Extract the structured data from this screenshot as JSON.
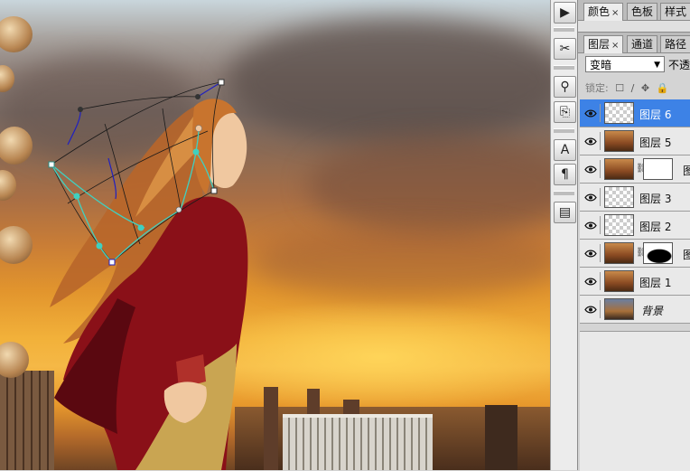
{
  "toolstrip": {
    "icons": [
      "play-icon",
      "brush-tools-icon",
      "clone-stamp-icon",
      "history-brush-icon",
      "character-icon",
      "paragraph-icon",
      "layer-comps-icon"
    ],
    "glyphs": [
      "▶",
      "✂",
      "⚲",
      "⎘",
      "A",
      "¶",
      "▤"
    ]
  },
  "panel_top": {
    "tabs": [
      {
        "label": "颜色",
        "close": "×"
      },
      {
        "label": "色板"
      },
      {
        "label": "样式"
      }
    ]
  },
  "layers_panel": {
    "tabs": [
      {
        "label": "图层",
        "close": "×"
      },
      {
        "label": "通道"
      },
      {
        "label": "路径"
      }
    ],
    "blend_mode": "变暗",
    "opacity_label": "不透",
    "lock_label": "锁定:",
    "lock_icons": [
      "lock-transparent-icon",
      "lock-paint-icon",
      "lock-move-icon",
      "lock-all-icon"
    ],
    "lock_glyphs": [
      "☐",
      "∕",
      "✥",
      "🔒"
    ],
    "layers": [
      {
        "name": "图层 6",
        "selected": true,
        "thumb": "checker"
      },
      {
        "name": "图层 5",
        "thumb": "photo"
      },
      {
        "name": "图",
        "thumb": "photo",
        "mask": "white"
      },
      {
        "name": "图层 3",
        "thumb": "checker"
      },
      {
        "name": "图层 2",
        "thumb": "checker"
      },
      {
        "name": "图",
        "thumb": "photo",
        "mask": "dark"
      },
      {
        "name": "图层 1",
        "thumb": "photo"
      },
      {
        "name": "背景",
        "thumb": "sky",
        "italic": true
      }
    ]
  },
  "colors": {
    "selection": "#3d82e6",
    "warp_handle": "#40d0c0"
  }
}
